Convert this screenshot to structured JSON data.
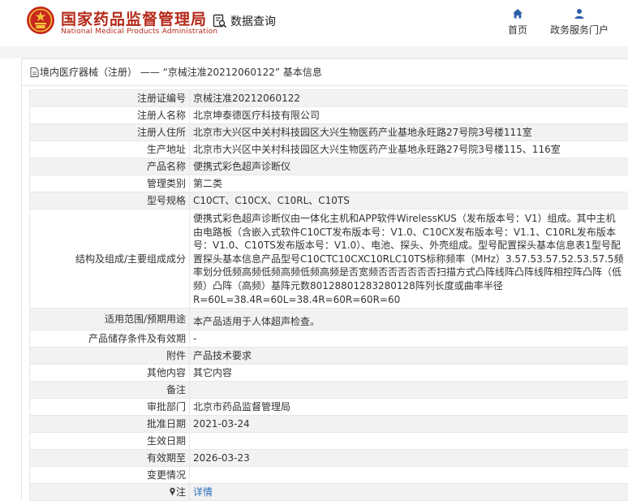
{
  "header": {
    "brand_cn": "国家药品监督管理局",
    "brand_en": "National Medical Products Administration",
    "search_label": "数据查询",
    "nav_home": "首页",
    "nav_services": "政务服务门户",
    "brand_color": "#b52a1a",
    "nav_icon_color": "#2a5fa8"
  },
  "breadcrumb": {
    "category": "境内医疗器械（注册）",
    "separator": "——",
    "detail": "“京械注准20212060122” 基本信息"
  },
  "rows": [
    {
      "label": "注册证编号",
      "value": "京械注准20212060122"
    },
    {
      "label": "注册人名称",
      "value": "北京坤泰德医疗科技有限公司"
    },
    {
      "label": "注册人住所",
      "value": "北京市大兴区中关村科技园区大兴生物医药产业基地永旺路27号院3号楼111室"
    },
    {
      "label": "生产地址",
      "value": "北京市大兴区中关村科技园区大兴生物医药产业基地永旺路27号院3号楼115、116室"
    },
    {
      "label": "产品名称",
      "value": "便携式彩色超声诊断仪"
    },
    {
      "label": "管理类别",
      "value": "第二类"
    },
    {
      "label": "型号规格",
      "value": "C10CT、C10CX、C10RL、C10TS"
    },
    {
      "label": "结构及组成/主要组成成分",
      "value": "便携式彩色超声诊断仪由一体化主机和APP软件WirelessKUS（发布版本号：V1）组成。其中主机由电路板（含嵌入式软件C10CT发布版本号：V1.0、C10CX发布版本号：V1.1、C10RL发布版本号：V1.0、C10TS发布版本号：V1.0）、电池、探头、外壳组成。型号配置探头基本信息表1型号配置探头基本信息产品型号C10CTC10CXC10RLC10TS标称频率（MHz）3.57.53.57.52.53.57.5频率划分低频高频低频高频低频高频是否宽频否否否否否否扫描方式凸阵线阵凸阵线阵相控阵凸阵（低频）凸阵（高频）基阵元数80128801283280128阵列长度或曲率半径R=60L=38.4R=60L=38.4R=60R=60R=60"
    },
    {
      "label": "适用范围/预期用途",
      "value": "本产品适用于人体超声检查。"
    },
    {
      "label": "产品储存条件及有效期",
      "value": "-"
    },
    {
      "label": "附件",
      "value": "产品技术要求"
    },
    {
      "label": "其他内容",
      "value": "其它内容"
    },
    {
      "label": "备注",
      "value": ""
    },
    {
      "label": "审批部门",
      "value": "北京市药品监督管理局"
    },
    {
      "label": "批准日期",
      "value": "2021-03-24"
    },
    {
      "label": "生效日期",
      "value": ""
    },
    {
      "label": "有效期至",
      "value": "2026-03-23"
    },
    {
      "label": "变更情况",
      "value": ""
    },
    {
      "label": "注",
      "value": "详情"
    }
  ]
}
